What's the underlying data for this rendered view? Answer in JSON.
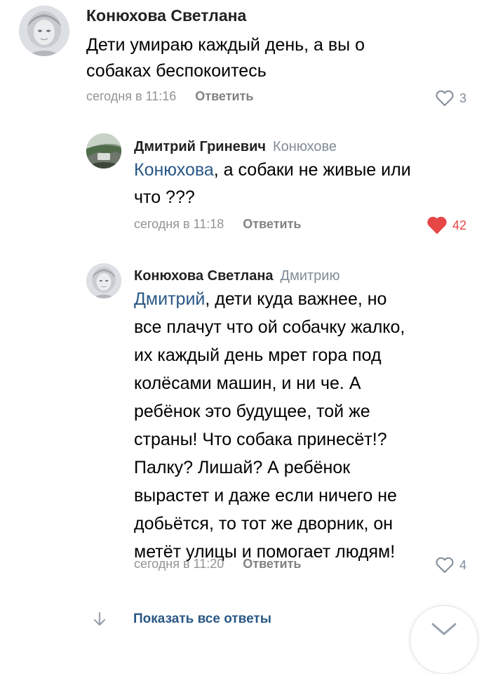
{
  "comments": [
    {
      "author": "Конюхова Светлана",
      "reply_to": "",
      "mention": "",
      "text_lines": [
        "Дети умираю каждый день, а вы о",
        "собаках беспокоитесь"
      ],
      "time": "сегодня в 11:16",
      "reply_label": "Ответить",
      "likes": "3",
      "liked": false
    },
    {
      "author": "Дмитрий Гриневич",
      "reply_to": "Конюхове",
      "mention": "Конюхова",
      "text_lines": [
        ", а собаки не живые или",
        "что ???"
      ],
      "time": "сегодня в 11:18",
      "reply_label": "Ответить",
      "likes": "42",
      "liked": true
    },
    {
      "author": "Конюхова Светлана",
      "reply_to": "Дмитрию",
      "mention": "Дмитрий",
      "text_lines": [
        ", дети куда важнее, но",
        "все плачут что ой собачку жалко,",
        "их каждый день мрет гора под",
        "колёсами машин, и ни че. А",
        "ребёнок это будущее, той же",
        "страны! Что собака принесёт!?",
        "Палку? Лишай? А ребёнок",
        "вырастет и даже если ничего не",
        "добьётся, то тот же дворник, он",
        "метёт улицы и помогает людям!"
      ],
      "time": "сегодня в 11:20",
      "reply_label": "Ответить",
      "likes": "4",
      "liked": false
    }
  ],
  "show_replies_label": "Показать все ответы",
  "icons": {
    "like": "heart-outline-icon",
    "liked": "heart-filled-icon",
    "show_replies": "arrow-down-icon",
    "scroll": "chevron-down-icon"
  },
  "colors": {
    "link": "#2a5885",
    "meta": "#939393",
    "liked": "#e64646",
    "like_outline": "#818c99"
  }
}
